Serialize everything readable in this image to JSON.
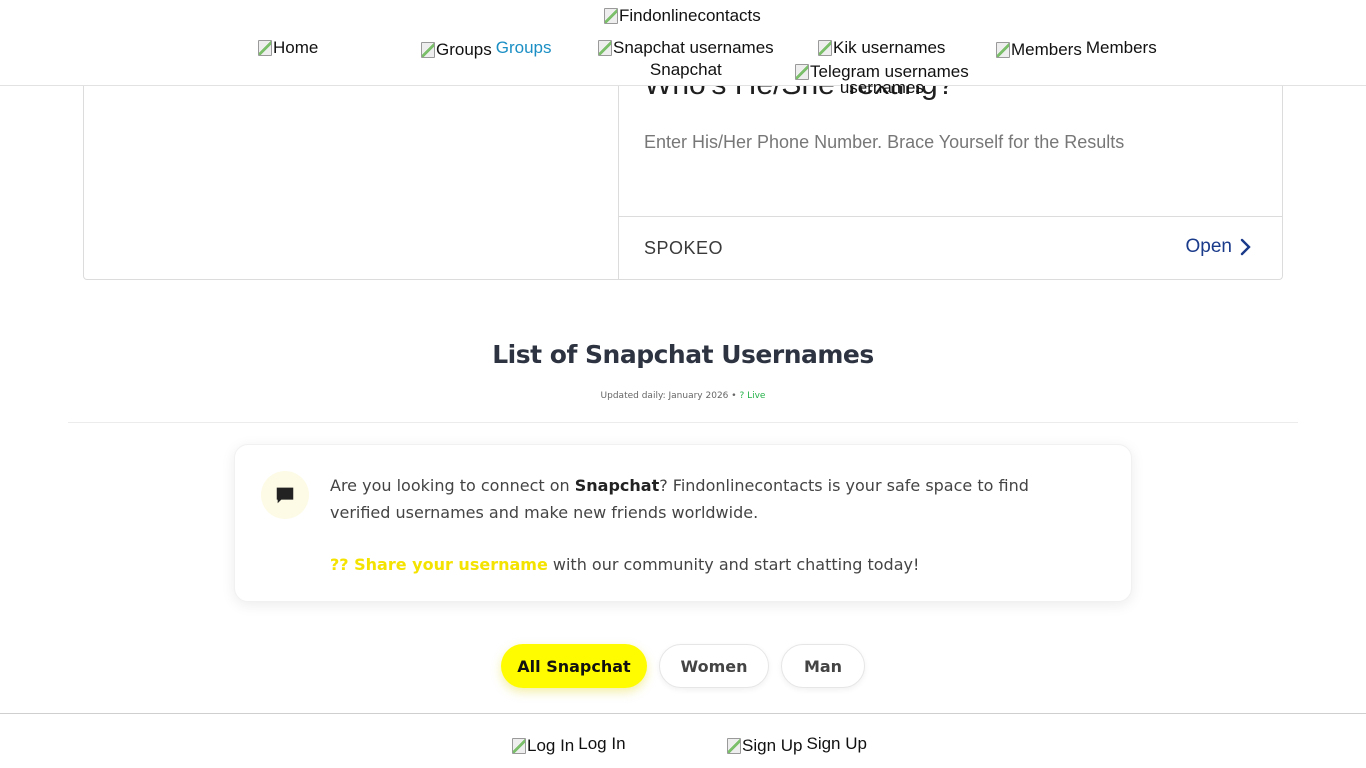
{
  "header": {
    "logo_alt": "Findonlinecontacts",
    "nav": {
      "home_alt": "Home",
      "groups_alt": "Groups",
      "groups_label": "Groups",
      "snapchat_alt": "Snapchat usernames",
      "snapchat_label": "Snapchat",
      "kik_alt": "Kik usernames",
      "telegram_alt": "Telegram usernames",
      "telegram_label": "usernames",
      "members_alt": "Members",
      "members_label": "Members"
    }
  },
  "ad": {
    "headline": "Who's He/She Texting?",
    "description": "Enter His/Her Phone Number. Brace Yourself for the Results",
    "brand": "SPOKEO",
    "cta": "Open"
  },
  "list": {
    "title": "List of Snapchat Usernames",
    "updated_text": "Updated daily: January 2026 • ",
    "live_text": "? Live"
  },
  "info": {
    "intro_before": "Are you looking to connect on ",
    "intro_bold": "Snapchat",
    "intro_after": "? Findonlinecontacts is your safe space to find verified usernames and make new friends worldwide.",
    "share_link": "?? Share your username",
    "share_rest": " with our community and start chatting today!",
    "icon": "chat-bubble-icon"
  },
  "filters": [
    {
      "label": "All Snapchat",
      "active": true
    },
    {
      "label": "Women",
      "active": false
    },
    {
      "label": "Man",
      "active": false
    }
  ],
  "bottom": {
    "login_alt": "Log In",
    "login_label": "Log In",
    "signup_alt": "Sign Up",
    "signup_label": "Sign Up"
  },
  "colors": {
    "accent_yellow": "#fffc00",
    "link_blue": "#1b8fc4",
    "cta_blue": "#1a3a8a",
    "live_green": "#26b24a"
  }
}
